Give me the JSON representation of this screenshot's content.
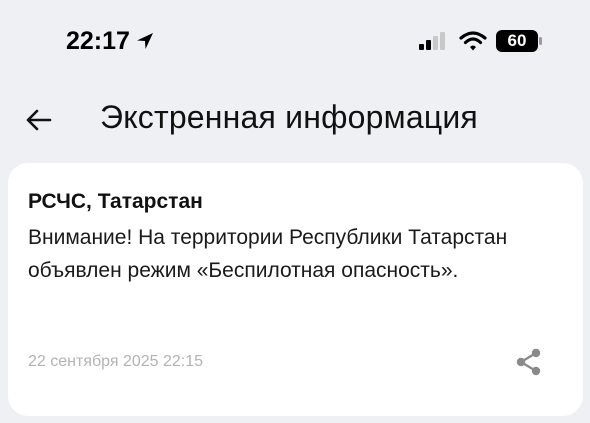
{
  "status_bar": {
    "time": "22:17",
    "battery_level": "60",
    "icons": [
      "location-arrow-icon",
      "cellular-signal-icon",
      "wifi-icon",
      "battery-icon"
    ]
  },
  "header": {
    "title": "Экстренная информация",
    "back_icon": "arrow-left-icon"
  },
  "alert": {
    "source": "РСЧС, Татарстан",
    "message": "Внимание! На территории Республики Татарстан объявлен режим «Беспилотная опасность».",
    "timestamp": "22 сентября 2025 22:15",
    "share_icon": "share-icon"
  },
  "colors": {
    "background": "#eef0f3",
    "card": "#ffffff",
    "timestamp": "#b3b3b3",
    "icon_gray": "#8a8a8a"
  }
}
